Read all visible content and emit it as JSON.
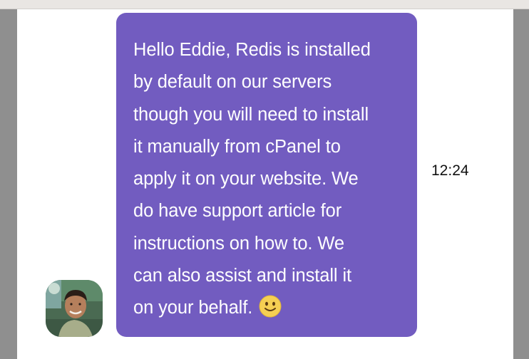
{
  "message": {
    "lines": [
      "Hello Eddie, Redis is installed",
      "by default on our servers",
      "though you will need to install",
      "it manually from cPanel to",
      "apply it on your website. We",
      "do have support article for",
      "instructions on how to. We",
      "can also assist and install it",
      "on your behalf."
    ],
    "time": "12:24",
    "emoji": "slightly-smiling-face-icon"
  },
  "colors": {
    "bubble": "#725cc0",
    "panel": "#ffffff",
    "sidebar": "#8f8f8f",
    "text": "#ffffff"
  }
}
